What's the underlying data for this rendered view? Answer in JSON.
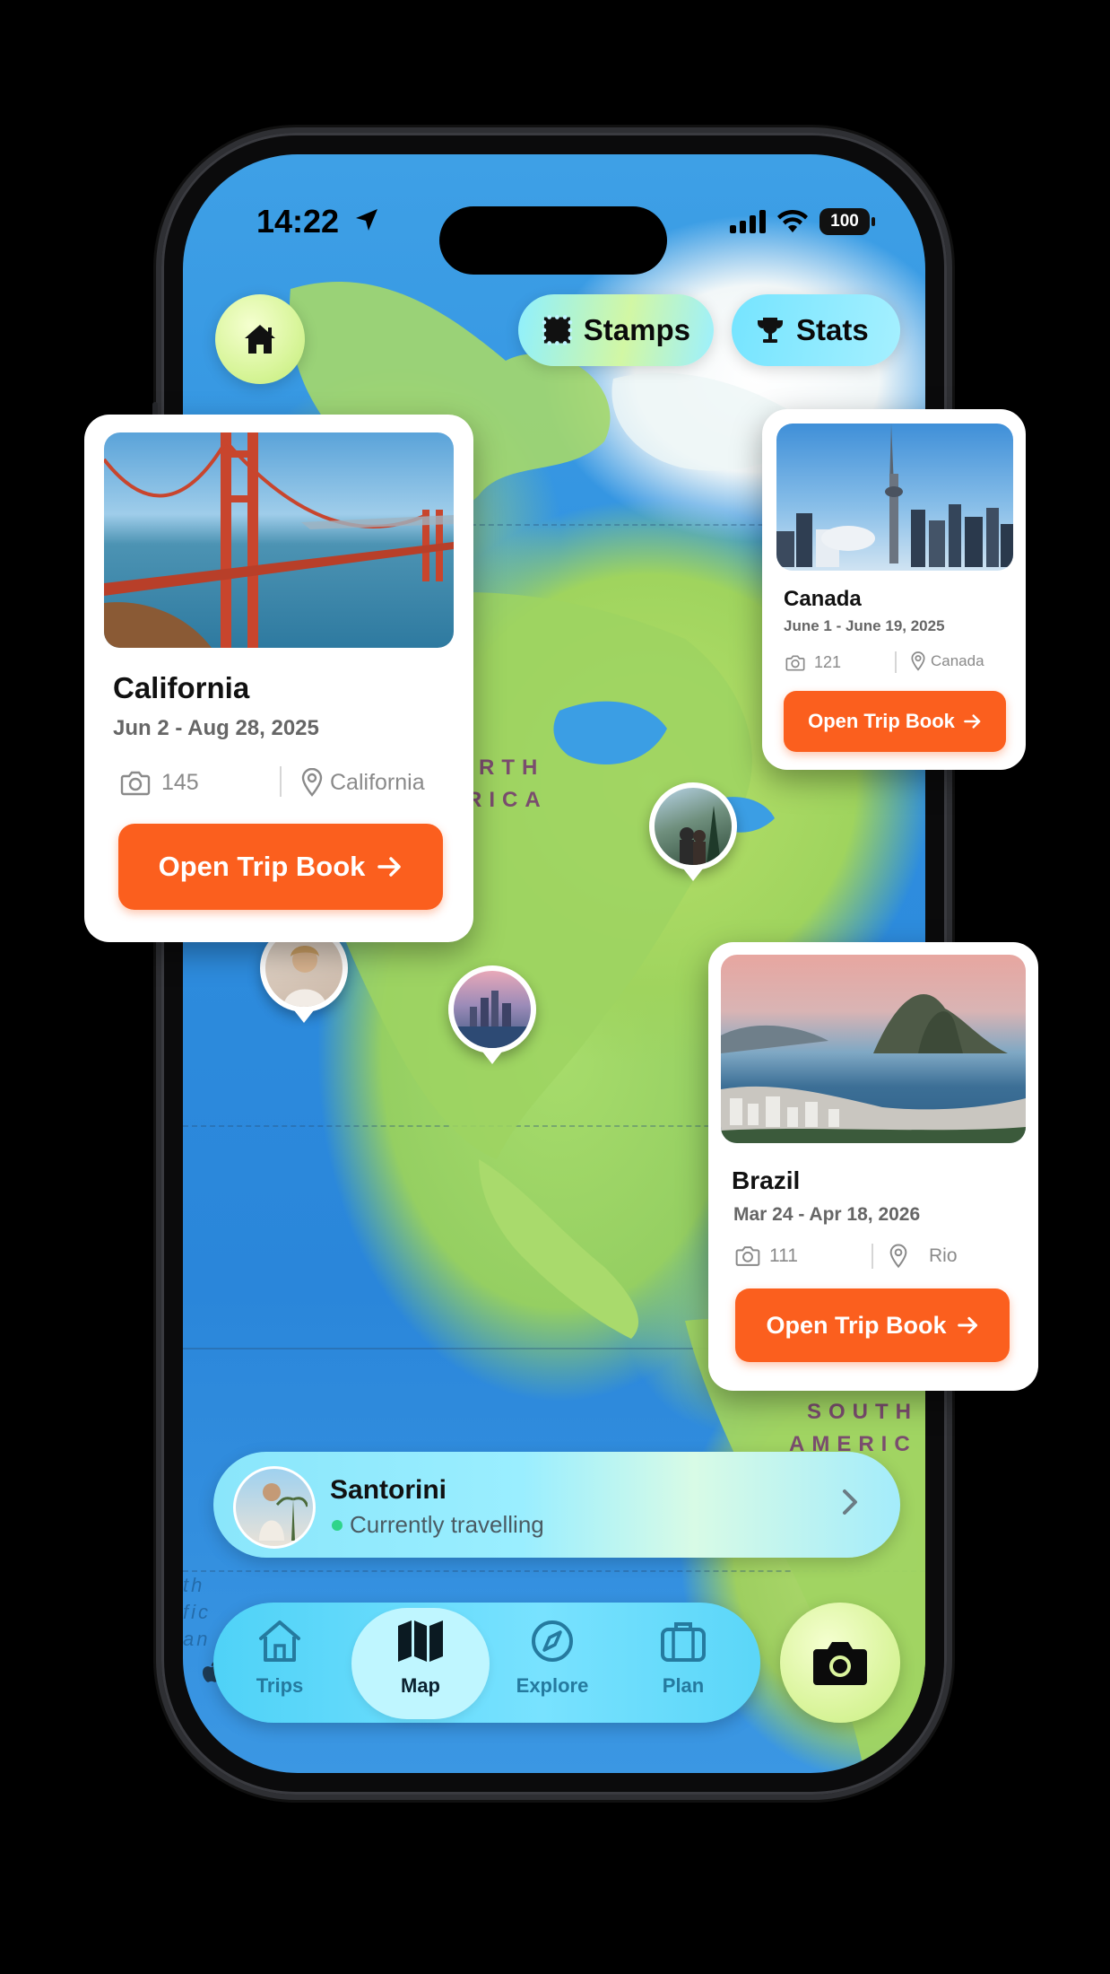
{
  "status_bar": {
    "time": "14:22",
    "battery": "100"
  },
  "top_actions": {
    "stamps_label": "Stamps",
    "stats_label": "Stats"
  },
  "map_labels": {
    "north_america_1": "RTH",
    "north_america_2": "RICA",
    "south_america_1": "SOUTH",
    "south_america_2": "AMERIC"
  },
  "ocean_fragments": [
    "th",
    "fic",
    "an"
  ],
  "trips": [
    {
      "title": "California",
      "dates": "Jun 2 - Aug 28, 2025",
      "photos": "145",
      "location": "California",
      "cta": "Open Trip Book"
    },
    {
      "title": "Canada",
      "dates": "June 1 - June 19, 2025",
      "photos": "121",
      "location": "Canada",
      "cta": "Open Trip Book"
    },
    {
      "title": "Brazil",
      "dates": "Mar 24 - Apr 18, 2026",
      "photos": "111",
      "location": "Rio",
      "cta": "Open Trip Book"
    }
  ],
  "current_trip": {
    "title": "Santorini",
    "status": "Currently travelling"
  },
  "tabs": [
    {
      "label": "Trips",
      "icon": "home-icon",
      "active": false
    },
    {
      "label": "Map",
      "icon": "map-icon",
      "active": true
    },
    {
      "label": "Explore",
      "icon": "compass-icon",
      "active": false
    },
    {
      "label": "Plan",
      "icon": "briefcase-icon",
      "active": false
    }
  ],
  "colors": {
    "accent": "#fb5f1e",
    "tab_bar": "#5bd6f8",
    "lime": "#d8f59a"
  }
}
